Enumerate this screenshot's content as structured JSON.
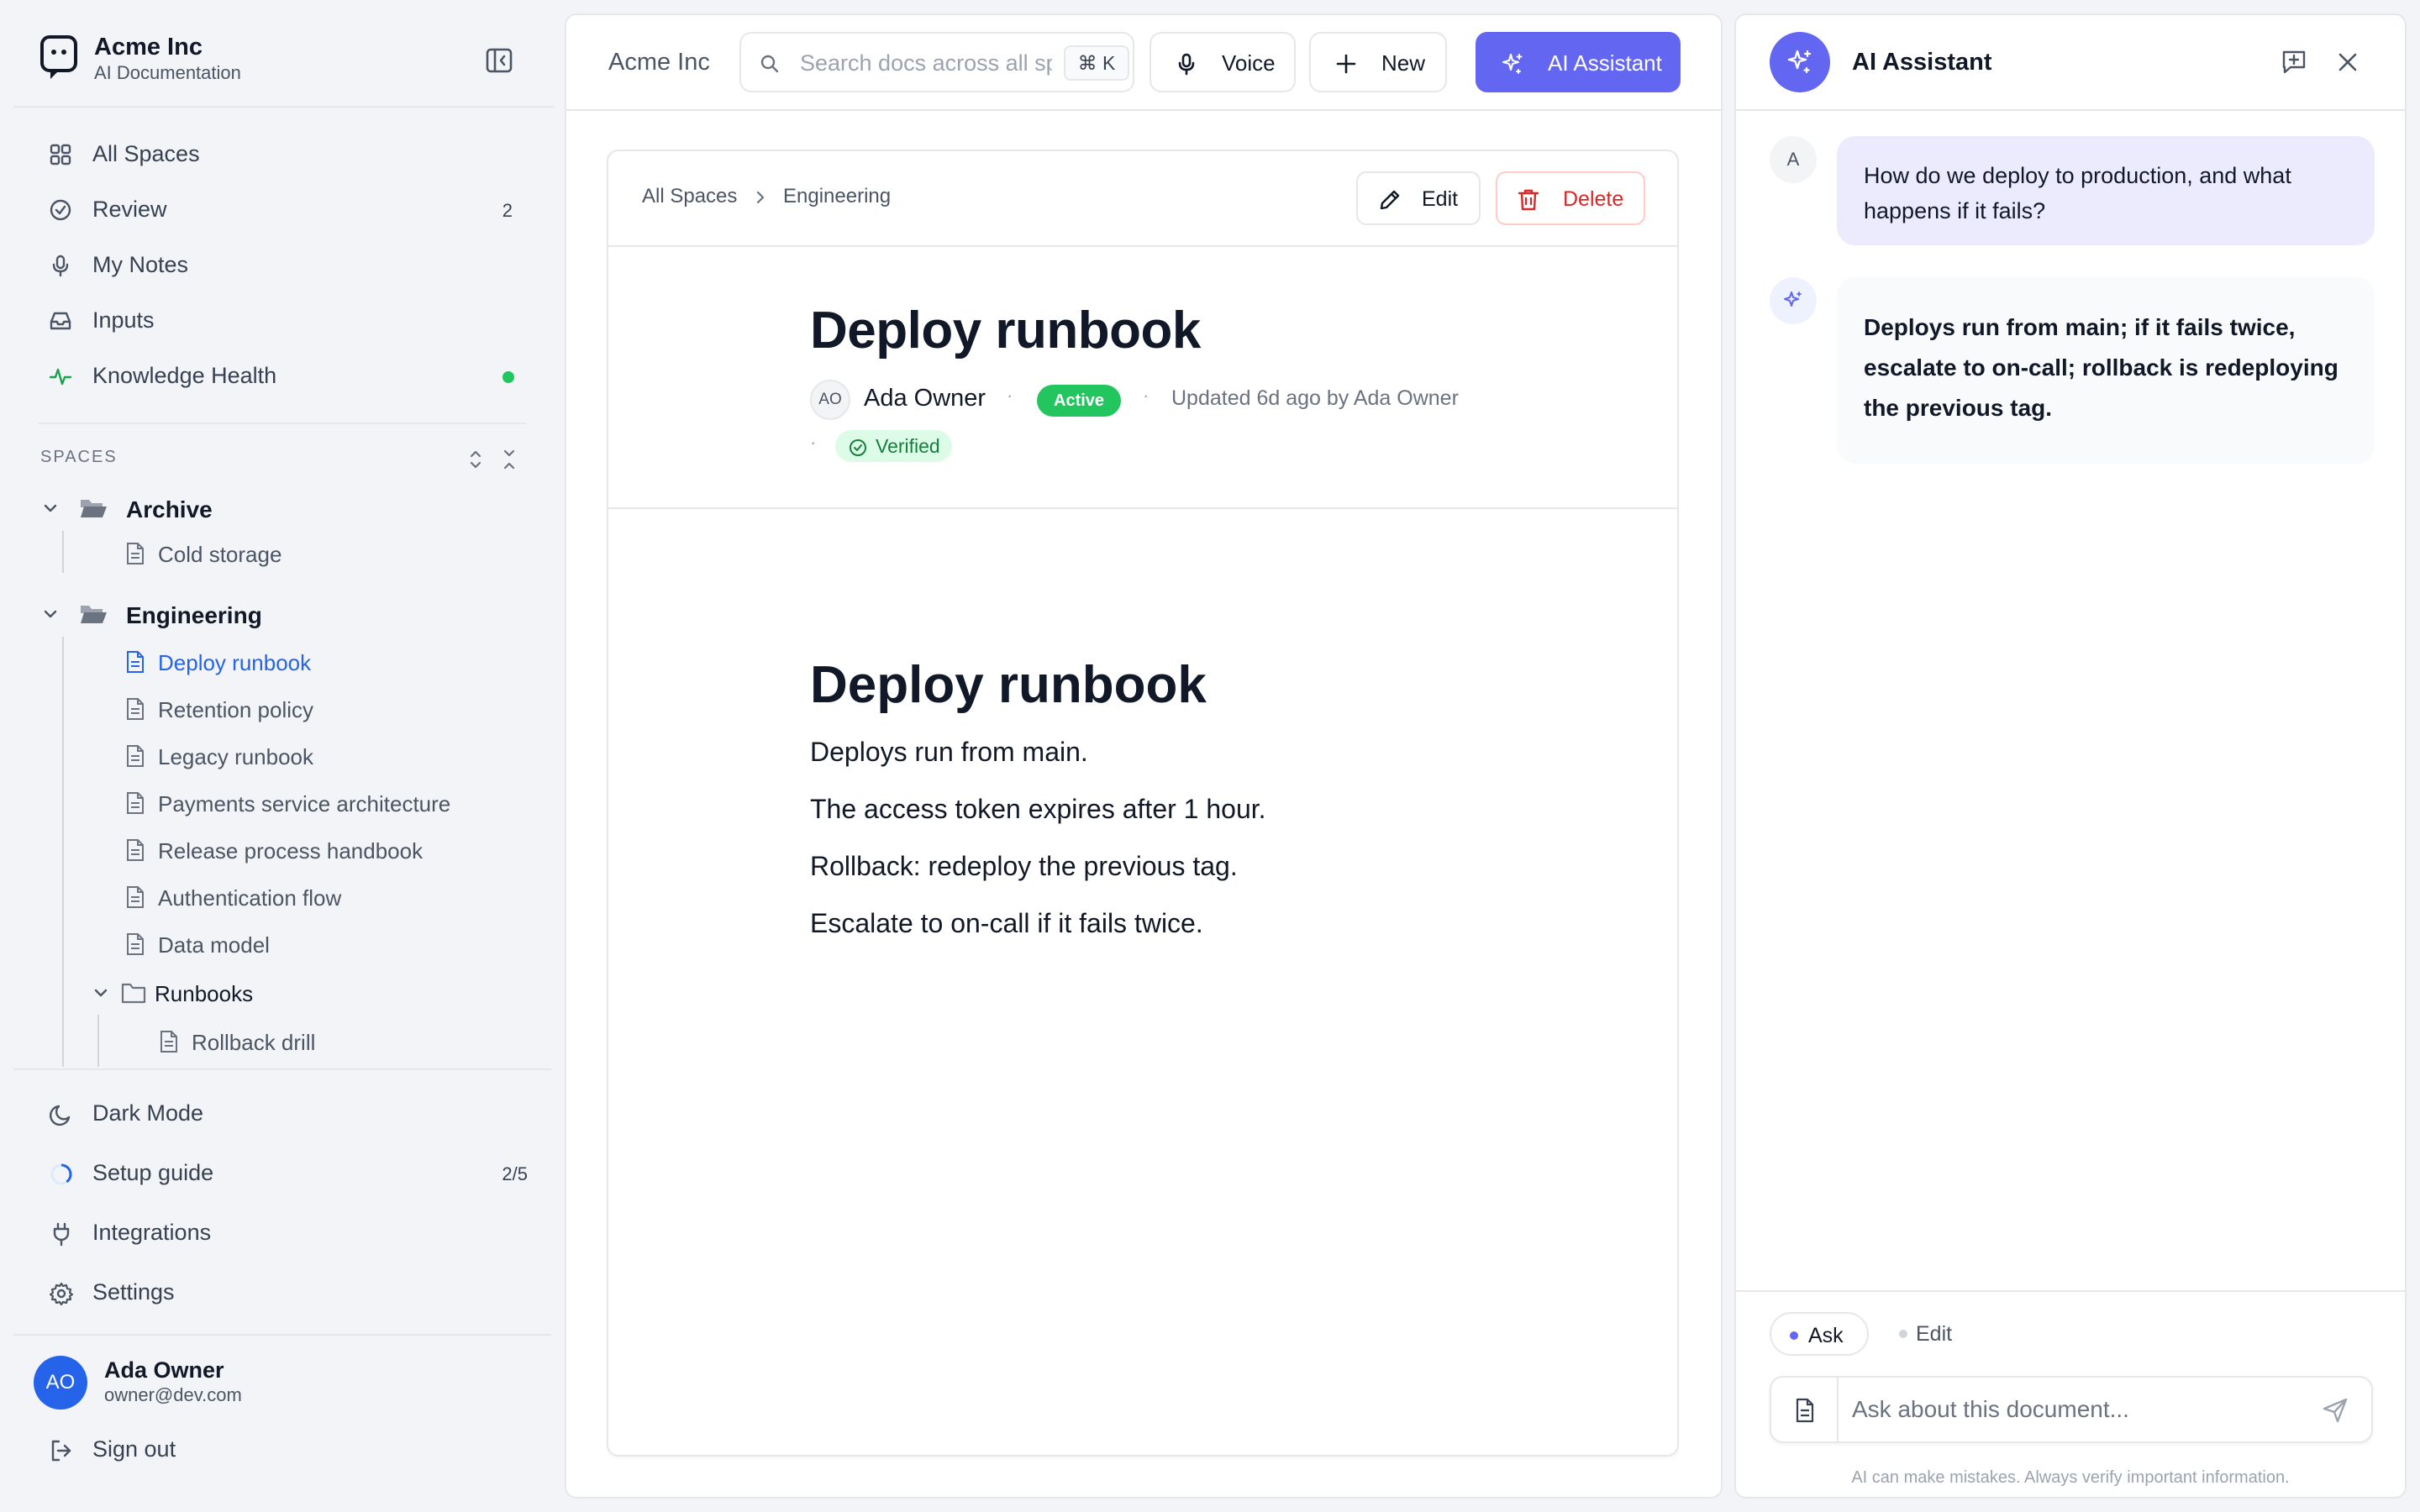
{
  "brand": {
    "name": "Acme Inc",
    "subtitle": "AI Documentation"
  },
  "nav": [
    {
      "label": "All Spaces",
      "icon": "grid-icon"
    },
    {
      "label": "Review",
      "icon": "check-circle-icon",
      "badge": "2"
    },
    {
      "label": "My Notes",
      "icon": "microphone-icon"
    },
    {
      "label": "Inputs",
      "icon": "inbox-icon"
    },
    {
      "label": "Knowledge Health",
      "icon": "activity-icon",
      "status_color": "#22c55e"
    }
  ],
  "spaces": {
    "heading": "SPACES",
    "tree": {
      "archive": {
        "label": "Archive",
        "children": [
          "Cold storage"
        ]
      },
      "engineering": {
        "label": "Engineering",
        "children": [
          "Deploy runbook",
          "Retention policy",
          "Legacy runbook",
          "Payments service architecture",
          "Release process handbook",
          "Authentication flow",
          "Data model"
        ],
        "active": "Deploy runbook"
      },
      "runbooks": {
        "label": "Runbooks",
        "children": [
          "Rollback drill"
        ]
      }
    }
  },
  "bottom_nav": [
    {
      "label": "Dark Mode",
      "icon": "moon-icon"
    },
    {
      "label": "Setup guide",
      "icon": "progress-ring-icon",
      "badge": "2/5",
      "progress": 0.4
    },
    {
      "label": "Integrations",
      "icon": "plug-icon"
    },
    {
      "label": "Settings",
      "icon": "gear-icon"
    }
  ],
  "user": {
    "initials": "AO",
    "name": "Ada Owner",
    "email": "owner@dev.com",
    "signout": "Sign out"
  },
  "topbar": {
    "company": "Acme Inc",
    "search_placeholder": "Search docs across all spaces",
    "shortcut": "⌘ K",
    "voice": "Voice",
    "new": "New",
    "ai_assistant": "AI Assistant"
  },
  "document": {
    "breadcrumb": [
      "All Spaces",
      "Engineering"
    ],
    "edit": "Edit",
    "delete": "Delete",
    "title": "Deploy runbook",
    "owner_initials": "AO",
    "owner": "Ada Owner",
    "status": "Active",
    "updated": "Updated 6d ago by Ada Owner",
    "verified": "Verified",
    "body_heading": "Deploy runbook",
    "body_lines": [
      "Deploys run from main.",
      "The access token expires after 1 hour.",
      "Rollback: redeploy the previous tag.",
      "Escalate to on-call if it fails twice."
    ]
  },
  "assistant": {
    "title": "AI Assistant",
    "user_initial": "A",
    "user_message": "How do we deploy to production, and what happens if it fails?",
    "ai_message": "Deploys run from main; if it fails twice, escalate to on-call; rollback is redeploying the previous tag.",
    "modes": [
      "Ask",
      "Edit"
    ],
    "active_mode": "Ask",
    "input_placeholder": "Ask about this document...",
    "disclaimer": "AI can make mistakes. Always verify important information."
  },
  "colors": {
    "accent": "#6366f1",
    "active_link": "#2563eb",
    "success": "#22c55e",
    "danger": "#dc2626"
  }
}
